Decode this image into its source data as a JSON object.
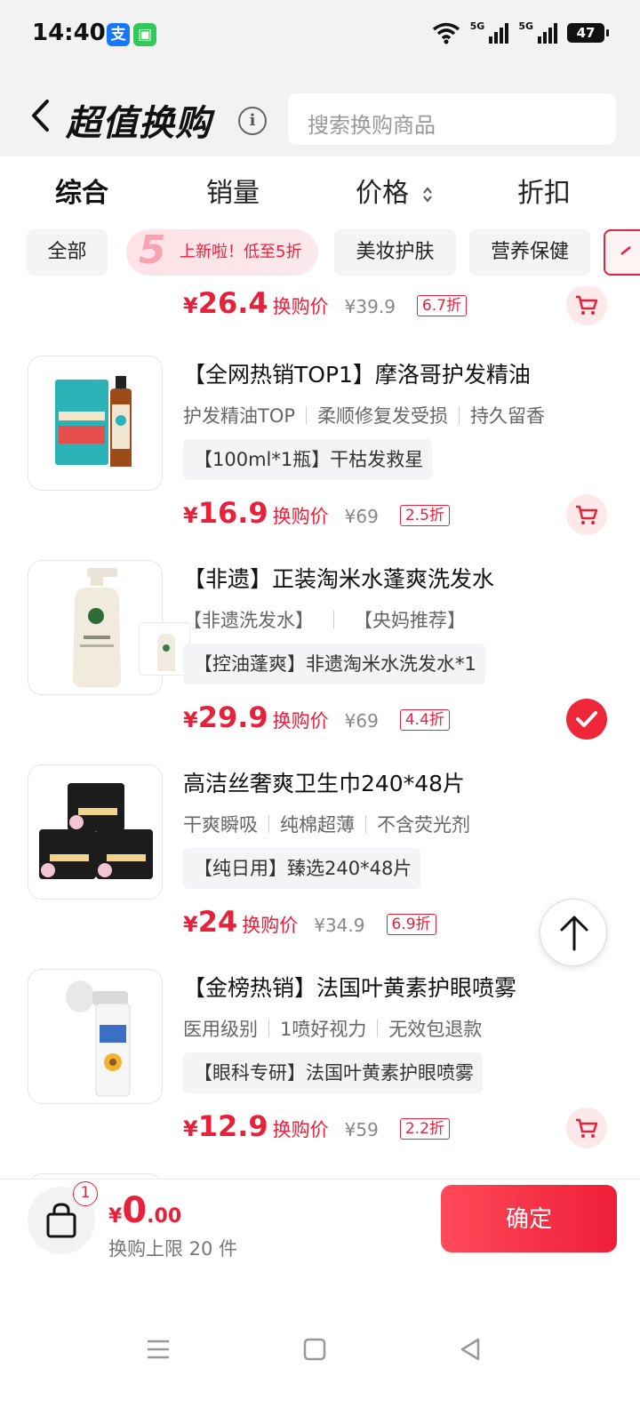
{
  "status_bar": {
    "time": "14:40",
    "app_icons": [
      {
        "name": "alipay-icon",
        "glyph": "支",
        "color": "#1677ff"
      },
      {
        "name": "wechat-mini-icon",
        "glyph": "▣",
        "color": "#34c759"
      }
    ],
    "signal_labels": [
      "5G",
      "5G"
    ],
    "battery": "47"
  },
  "header": {
    "title": "超值换购",
    "info_glyph": "i",
    "search_placeholder": "搜索换购商品"
  },
  "sort_tabs": [
    {
      "label": "综合",
      "active": true
    },
    {
      "label": "销量",
      "active": false
    },
    {
      "label": "价格",
      "active": false
    },
    {
      "label": "折扣",
      "active": false
    }
  ],
  "filter_chips": {
    "all": "全部",
    "promo_number": "5",
    "promo": "上新啦！低至5折",
    "beauty": "美妆护肤",
    "nutrition": "营养保健"
  },
  "items": [
    {
      "title": "",
      "tags": [],
      "spec": "",
      "price": "26.4",
      "price_label": "换购价",
      "original": "¥39.9",
      "discount": "6.7折",
      "selected": false
    },
    {
      "title": "【全网热销TOP1】摩洛哥护发精油",
      "tags": [
        "护发精油TOP",
        "柔顺修复发受损",
        "持久留香"
      ],
      "spec": "【100ml*1瓶】干枯发救星",
      "price": "16.9",
      "price_label": "换购价",
      "original": "¥69",
      "discount": "2.5折",
      "selected": false
    },
    {
      "title": "【非遗】正装淘米水蓬爽洗发水",
      "tags": [
        "【非遗洗发水】",
        "【央妈推荐】"
      ],
      "spec": "【控油蓬爽】非遗淘米水洗发水*1",
      "price": "29.9",
      "price_label": "换购价",
      "original": "¥69",
      "discount": "4.4折",
      "selected": true
    },
    {
      "title": "高洁丝奢爽卫生巾240*48片",
      "tags": [
        "干爽瞬吸",
        "纯棉超薄",
        "不含荧光剂"
      ],
      "spec": "【纯日用】臻选240*48片",
      "price": "24",
      "price_label": "换购价",
      "original": "¥34.9",
      "discount": "6.9折",
      "selected": false
    },
    {
      "title": "【金榜热销】法国叶黄素护眼喷雾",
      "tags": [
        "医用级别",
        "1喷好视力",
        "无效包退款"
      ],
      "spec": "【眼科专研】法国叶黄素护眼喷雾",
      "price": "12.9",
      "price_label": "换购价",
      "original": "¥59",
      "discount": "2.2折",
      "selected": false
    }
  ],
  "currency_symbol": "¥",
  "bottom_bar": {
    "badge_count": "1",
    "total_yen": "¥",
    "total_integer": "0",
    "total_decimal": ".00",
    "limit_text": "换购上限 20 件",
    "confirm_label": "确定"
  },
  "colors": {
    "accent": "#e8213b",
    "header_bg": "#f2f2f2"
  }
}
